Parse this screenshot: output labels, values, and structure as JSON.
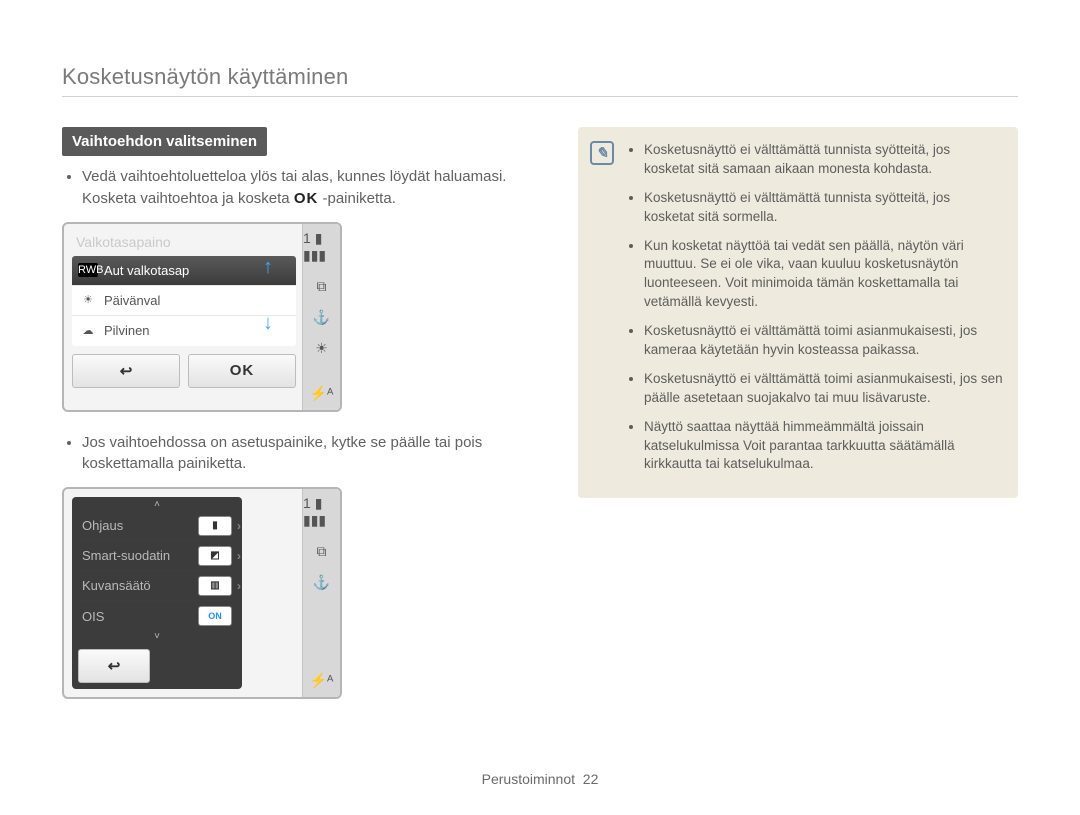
{
  "page_title": "Kosketusnäytön käyttäminen",
  "section_heading": "Vaihtoehdon valitseminen",
  "left_list_1": "Vedä vaihtoehtoluetteloa ylös tai alas, kunnes löydät haluamasi. Kosketa vaihtoehtoa ja kosketa ",
  "left_list_1_ok": "OK",
  "left_list_1_tail": "-painiketta.",
  "left_list_2": "Jos vaihtoehdossa on asetuspainike, kytke se päälle tai pois koskettamalla painiketta.",
  "shot1": {
    "title": "Valkotasapaino",
    "items": [
      {
        "iconText": "RWB",
        "label": "Aut valkotasap",
        "selected": true,
        "iconClass": "rwb"
      },
      {
        "iconText": "☀",
        "label": "Päivänval",
        "selected": false,
        "iconClass": ""
      },
      {
        "iconText": "☁",
        "label": "Pilvinen",
        "selected": false,
        "iconClass": ""
      }
    ],
    "back": "↩",
    "ok": "OK",
    "side": {
      "count": "1",
      "battery": "▮▮▮",
      "i2": "⧉",
      "i3": "⚓",
      "brightness": "☀",
      "flashA": "⚡ᴬ"
    }
  },
  "shot2": {
    "rows": [
      {
        "label": "Ohjaus",
        "toggle": "▮",
        "on": false
      },
      {
        "label": "Smart-suodatin",
        "toggle": "◩",
        "on": false
      },
      {
        "label": "Kuvansäätö",
        "toggle": "▥",
        "on": false
      },
      {
        "label": "OIS",
        "toggle": "ON",
        "on": true
      }
    ],
    "back": "↩",
    "side": {
      "count": "1",
      "battery": "▮▮▮",
      "i2": "⧉",
      "i3": "⚓",
      "flashA": "⚡ᴬ"
    }
  },
  "infobox": [
    "Kosketusnäyttö ei välttämättä tunnista syötteitä, jos kosketat sitä samaan aikaan monesta kohdasta.",
    "Kosketusnäyttö ei välttämättä tunnista syötteitä, jos kosketat sitä sormella.",
    "Kun kosketat näyttöä tai vedät sen päällä, näytön väri muuttuu. Se ei ole vika, vaan kuuluu kosketusnäytön luonteeseen. Voit minimoida tämän koskettamalla tai vetämällä kevyesti.",
    "Kosketusnäyttö ei välttämättä toimi asianmukaisesti, jos kameraa käytetään hyvin kosteassa paikassa.",
    "Kosketusnäyttö ei välttämättä toimi asianmukaisesti, jos sen päälle asetetaan suojakalvo tai muu lisävaruste.",
    "Näyttö saattaa näyttää himmeämmältä joissain katselukulmissa Voit parantaa tarkkuutta säätämällä kirkkautta tai katselukulmaa."
  ],
  "footer_label": "Perustoiminnot",
  "footer_page": "22"
}
